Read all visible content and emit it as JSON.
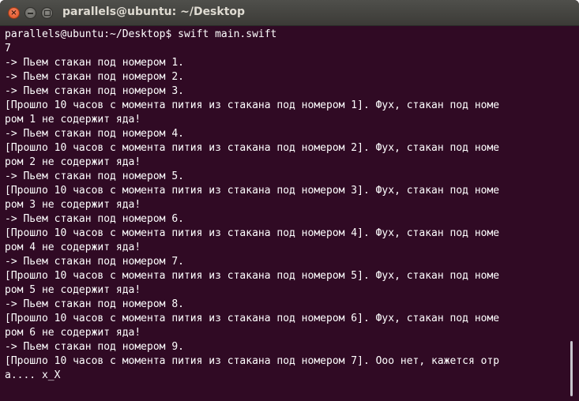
{
  "window": {
    "title": "parallels@ubuntu: ~/Desktop",
    "close_icon": "×",
    "minimize_icon": "–"
  },
  "terminal": {
    "lines": [
      "parallels@ubuntu:~/Desktop$ swift main.swift",
      "7",
      "-> Пьем стакан под номером 1.",
      "-> Пьем стакан под номером 2.",
      "-> Пьем стакан под номером 3.",
      "[Прошло 10 часов с момента пития из стакана под номером 1]. Фух, стакан под номе",
      "ром 1 не содержит яда!",
      "-> Пьем стакан под номером 4.",
      "[Прошло 10 часов с момента пития из стакана под номером 2]. Фух, стакан под номе",
      "ром 2 не содержит яда!",
      "-> Пьем стакан под номером 5.",
      "[Прошло 10 часов с момента пития из стакана под номером 3]. Фух, стакан под номе",
      "ром 3 не содержит яда!",
      "-> Пьем стакан под номером 6.",
      "[Прошло 10 часов с момента пития из стакана под номером 4]. Фух, стакан под номе",
      "ром 4 не содержит яда!",
      "-> Пьем стакан под номером 7.",
      "[Прошло 10 часов с момента пития из стакана под номером 5]. Фух, стакан под номе",
      "ром 5 не содержит яда!",
      "-> Пьем стакан под номером 8.",
      "[Прошло 10 часов с момента пития из стакана под номером 6]. Фух, стакан под номе",
      "ром 6 не содержит яда!",
      "-> Пьем стакан под номером 9.",
      "[Прошло 10 часов с момента пития из стакана под номером 7]. Ооо нет, кажется отр",
      "а.... x_X"
    ]
  },
  "colors": {
    "terminal_background": "#300a24",
    "terminal_text": "#ffffff",
    "titlebar": "#3c3b37",
    "title_text": "#dfdbd2",
    "close_button": "#df4a16"
  }
}
